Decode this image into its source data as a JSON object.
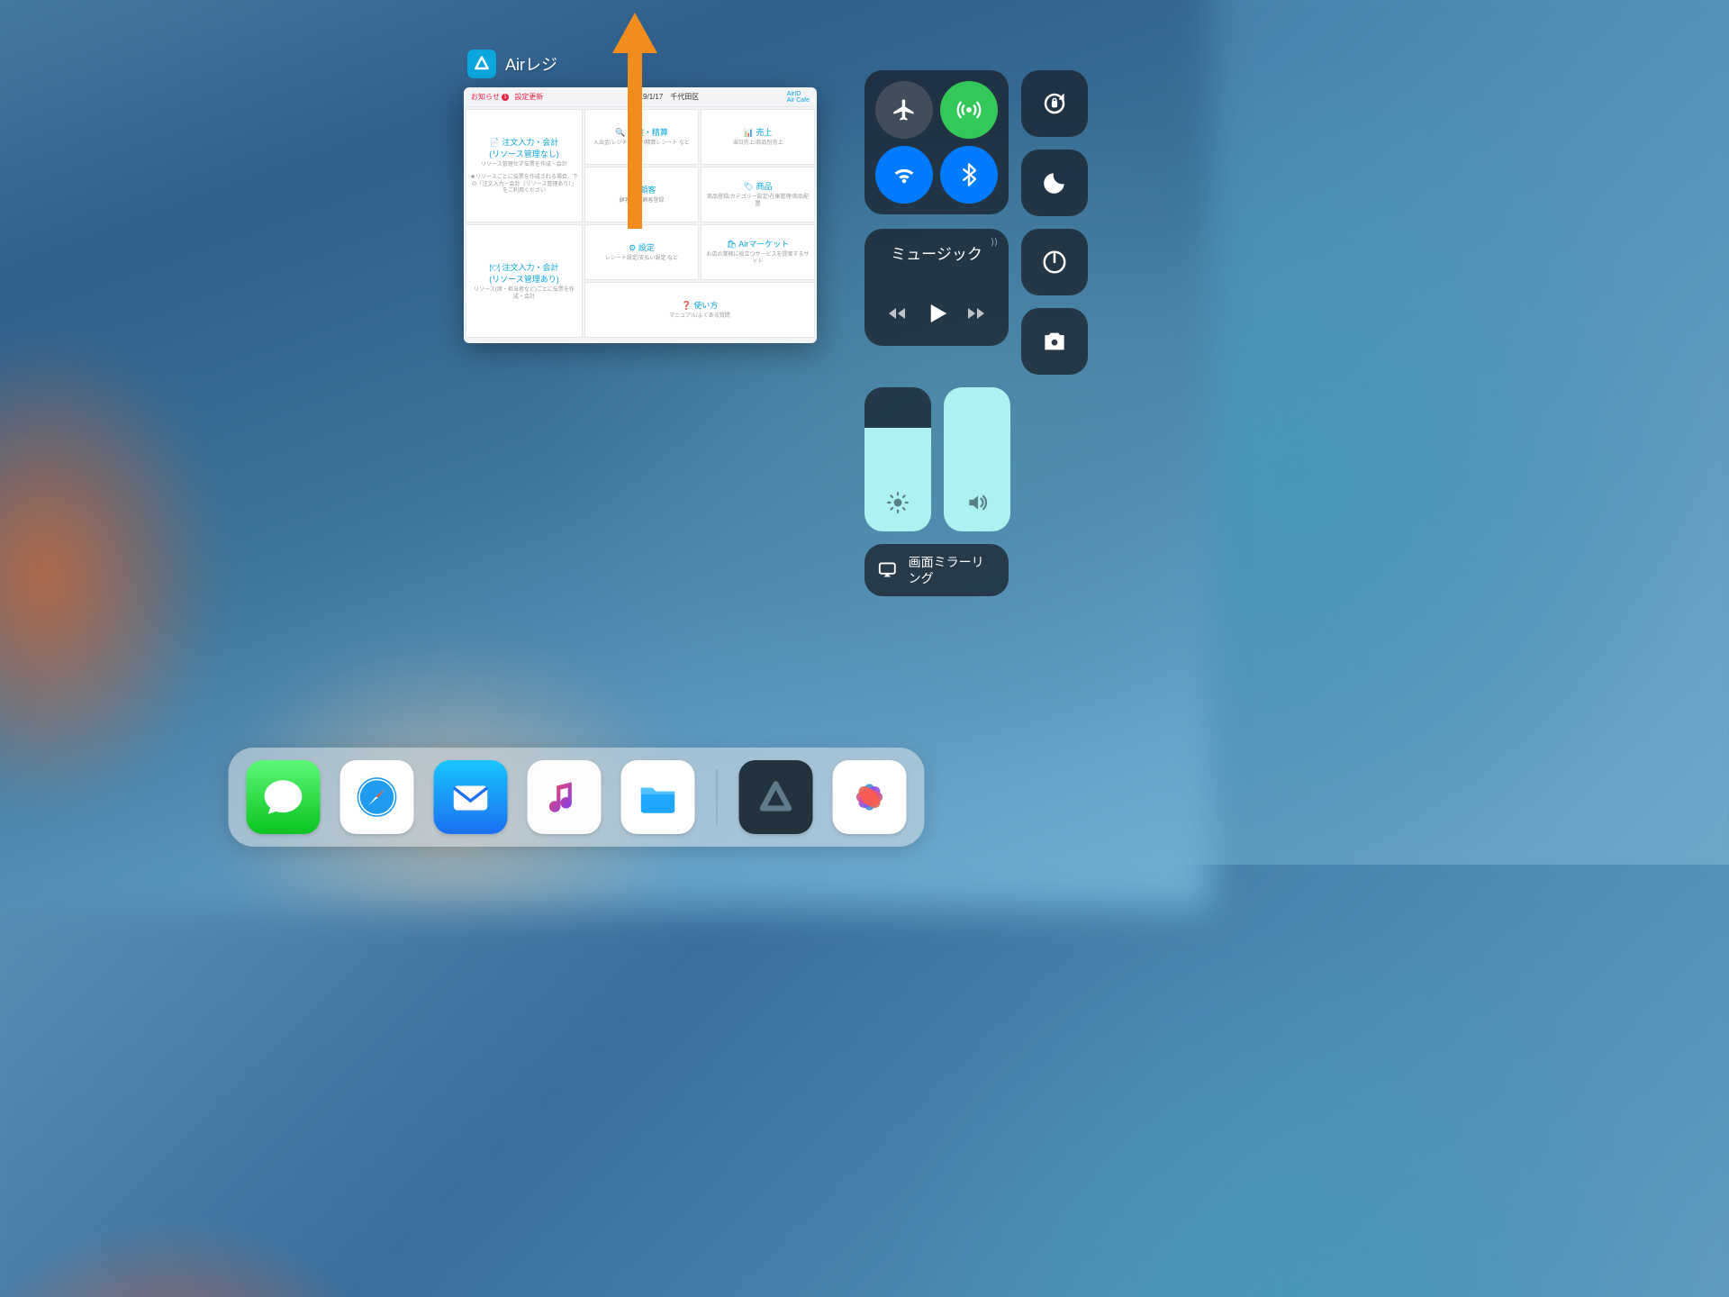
{
  "switcher": {
    "app_name": "Airレジ",
    "top": {
      "left": "お知らせ",
      "left2": "設定更新",
      "center": "2019/1/17　千代田区",
      "right1": "AirID",
      "right2": "Air Cafe"
    },
    "cells": {
      "c1_title": "注文入力・会計",
      "c1_sub": "(リソース管理なし)",
      "c1_desc": "リソース管理せず伝票を作成・会計",
      "c1_note": "★リソースごとに伝票を作成される場合、下の「注文入力・会計（リソース管理あり）」をご利用ください",
      "c2_title": "点検・精算",
      "c2_desc": "入出金/レジチェック/精算レシート など",
      "c3_title": "売上",
      "c3_desc": "当日売上/商品別売上",
      "c4_title": "顧客",
      "c4_desc": "顧客一覧/顧客登録",
      "c5_title": "商品",
      "c5_desc": "商品登録/カテゴリー設定/在庫管理/商品配置",
      "c6_title": "注文入力・会計",
      "c6_sub": "(リソース管理あり)",
      "c6_desc": "リソース(席・担当者など)ごとに伝票を作成・会計",
      "c7_title": "設定",
      "c7_desc": "レシート設定/支払い設定 など",
      "c8_title": "Airマーケット",
      "c8_desc": "お店の業務に役立つサービスを提案するサイト",
      "c9_title": "使い方",
      "c9_desc": "マニュアル/よくある質問"
    }
  },
  "control_center": {
    "music_label": "ミュージック",
    "mirror_label": "画面ミラーリング",
    "brightness_pct": 72,
    "volume_pct": 100,
    "toggles": {
      "airplane": false,
      "cellular": true,
      "wifi": true,
      "bluetooth": true,
      "orientation_lock": false,
      "dnd": false
    }
  },
  "dock": {
    "apps_main": [
      "messages",
      "safari",
      "mail",
      "music",
      "files"
    ],
    "apps_recent": [
      "airregister",
      "photos"
    ]
  }
}
